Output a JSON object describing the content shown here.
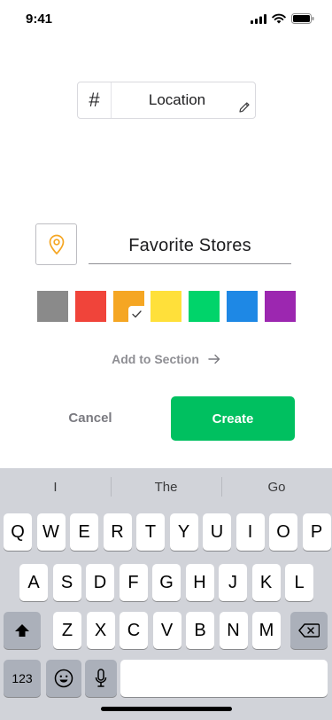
{
  "status_bar": {
    "time": "9:41",
    "icons": [
      "cellular-signal-icon",
      "wifi-icon",
      "battery-icon"
    ]
  },
  "category": {
    "prefix_icon": "hash-icon",
    "prefix_glyph": "#",
    "name": "Location",
    "edit_icon": "pencil-icon"
  },
  "list": {
    "icon": "map-pin-icon",
    "icon_color": "#f5a623",
    "name": "Favorite Stores"
  },
  "colors": {
    "selected_index": 2,
    "swatches": [
      "#8a8a8a",
      "#f0443a",
      "#f5a623",
      "#ffe03a",
      "#00d46a",
      "#1e88e5",
      "#9c27b0"
    ]
  },
  "add_section": {
    "label": "Add to Section",
    "icon": "arrow-right-icon"
  },
  "actions": {
    "cancel_label": "Cancel",
    "create_label": "Create",
    "create_color": "#00c060"
  },
  "keyboard": {
    "suggestions": [
      "I",
      "The",
      "Go"
    ],
    "row1": [
      "Q",
      "W",
      "E",
      "R",
      "T",
      "Y",
      "U",
      "I",
      "O",
      "P"
    ],
    "row2": [
      "A",
      "S",
      "D",
      "F",
      "G",
      "H",
      "J",
      "K",
      "L"
    ],
    "row3": [
      "Z",
      "X",
      "C",
      "V",
      "B",
      "N",
      "M"
    ],
    "numbers_label": "123",
    "shift_icon": "shift-icon",
    "backspace_icon": "backspace-icon",
    "emoji_icon": "emoji-icon",
    "mic_icon": "microphone-icon"
  }
}
